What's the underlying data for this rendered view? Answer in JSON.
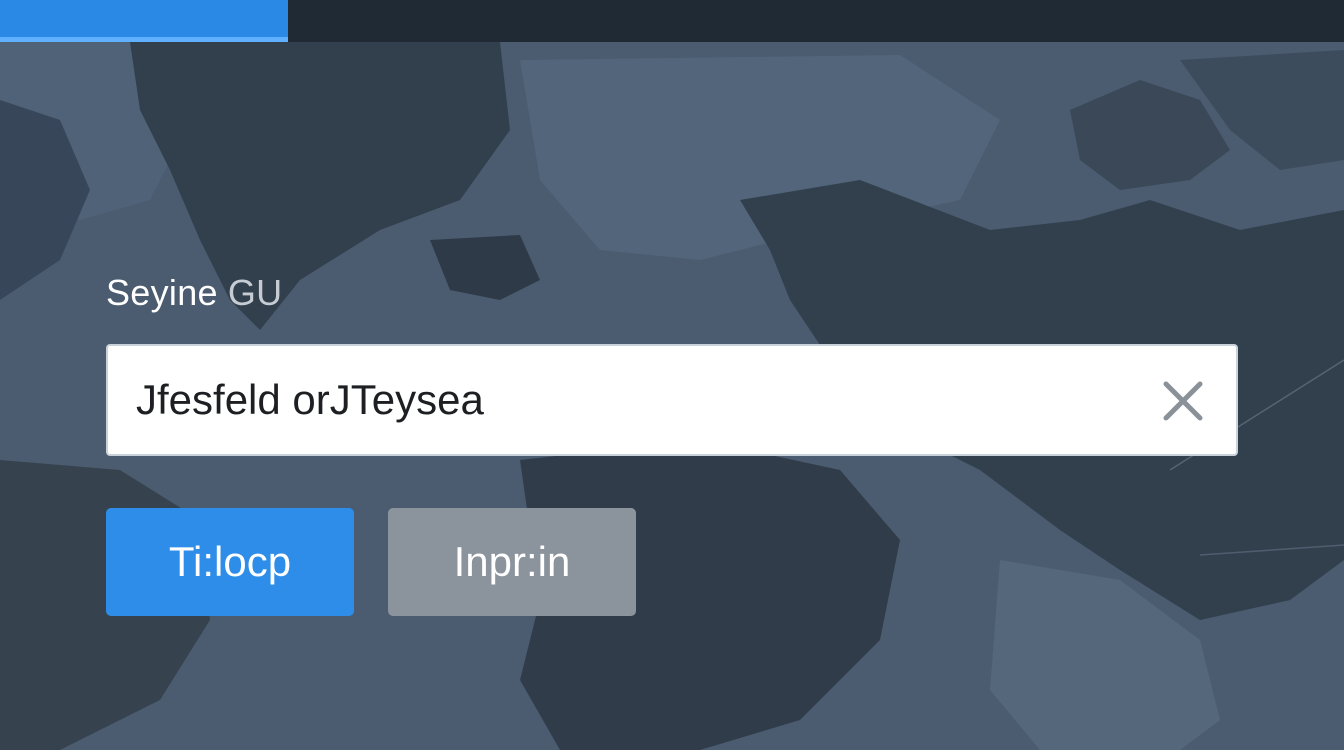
{
  "header": {
    "active_tab_color": "#2b89e6",
    "bar_color": "#1f2a35"
  },
  "form": {
    "label": "Seyine",
    "label_suffix": "GU",
    "input_value": "Jfesfeld orJTeysea",
    "clear_icon": "close-icon"
  },
  "actions": {
    "primary_label": "Ti:locp",
    "secondary_label": "Inpr:in",
    "primary_color": "#2d8de8",
    "secondary_color": "#8b939c"
  },
  "background": {
    "kind": "world-map",
    "base_color": "#4a5b6e",
    "land_color": "#34414f"
  }
}
